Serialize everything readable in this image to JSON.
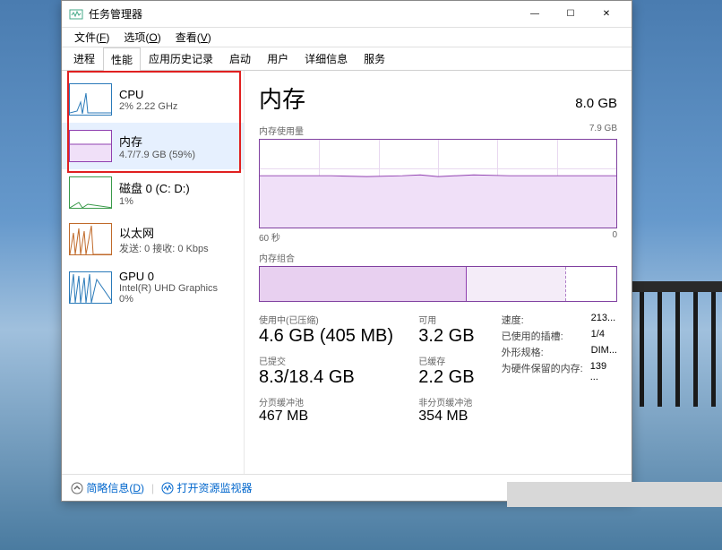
{
  "window": {
    "title": "任务管理器",
    "controls": {
      "min": "—",
      "max": "☐",
      "close": "✕"
    }
  },
  "menubar": [
    {
      "label": "文件",
      "key": "F"
    },
    {
      "label": "选项",
      "key": "O"
    },
    {
      "label": "查看",
      "key": "V"
    }
  ],
  "tabs": [
    {
      "label": "进程"
    },
    {
      "label": "性能",
      "active": true
    },
    {
      "label": "应用历史记录"
    },
    {
      "label": "启动"
    },
    {
      "label": "用户"
    },
    {
      "label": "详细信息"
    },
    {
      "label": "服务"
    }
  ],
  "sidebar": [
    {
      "id": "cpu",
      "title": "CPU",
      "sub": "2% 2.22 GHz",
      "color": "#2a7ab9"
    },
    {
      "id": "memory",
      "title": "内存",
      "sub": "4.7/7.9 GB (59%)",
      "color": "#9040b0",
      "selected": true
    },
    {
      "id": "disk",
      "title": "磁盘 0 (C: D:)",
      "sub": "1%",
      "color": "#3a9a4a"
    },
    {
      "id": "ethernet",
      "title": "以太网",
      "sub": "发送: 0 接收: 0 Kbps",
      "color": "#c06a2a"
    },
    {
      "id": "gpu",
      "title": "GPU 0",
      "sub": "Intel(R) UHD Graphics",
      "sub2": "0%",
      "color": "#2a7ab9"
    }
  ],
  "main": {
    "title": "内存",
    "capacity": "8.0 GB",
    "usage_label": "内存使用量",
    "usage_max": "7.9 GB",
    "axis_left": "60 秒",
    "axis_right": "0",
    "composition_label": "内存组合",
    "stats": {
      "in_use_label": "使用中(已压缩)",
      "in_use_value": "4.6 GB (405 MB)",
      "available_label": "可用",
      "available_value": "3.2 GB",
      "committed_label": "已提交",
      "committed_value": "8.3/18.4 GB",
      "cached_label": "已缓存",
      "cached_value": "2.2 GB",
      "paged_label": "分页缓冲池",
      "paged_value": "467 MB",
      "nonpaged_label": "非分页缓冲池",
      "nonpaged_value": "354 MB"
    },
    "info": [
      {
        "key": "速度:",
        "val": "213..."
      },
      {
        "key": "已使用的插槽:",
        "val": "1/4"
      },
      {
        "key": "外形规格:",
        "val": "DIM..."
      },
      {
        "key": "为硬件保留的内存:",
        "val": "139 ..."
      }
    ]
  },
  "footer": {
    "less": "简略信息",
    "less_key": "D",
    "monitor": "打开资源监视器"
  },
  "chart_data": {
    "type": "line",
    "title": "内存使用量",
    "xlabel": "60 秒",
    "ylabel": "",
    "ylim": [
      0,
      7.9
    ],
    "x_range_seconds": [
      60,
      0
    ],
    "series": [
      {
        "name": "内存",
        "values": [
          4.7,
          4.7,
          4.7,
          4.65,
          4.7,
          4.7,
          4.7,
          4.7,
          4.72,
          4.68,
          4.7,
          4.7,
          4.75,
          4.7,
          4.7,
          4.7,
          4.68,
          4.7,
          4.7,
          4.7
        ]
      }
    ],
    "composition": {
      "in_use_gb": 4.6,
      "compressed_mb": 405,
      "cached_gb": 2.2,
      "available_gb": 3.2,
      "total_gb": 7.9
    }
  }
}
